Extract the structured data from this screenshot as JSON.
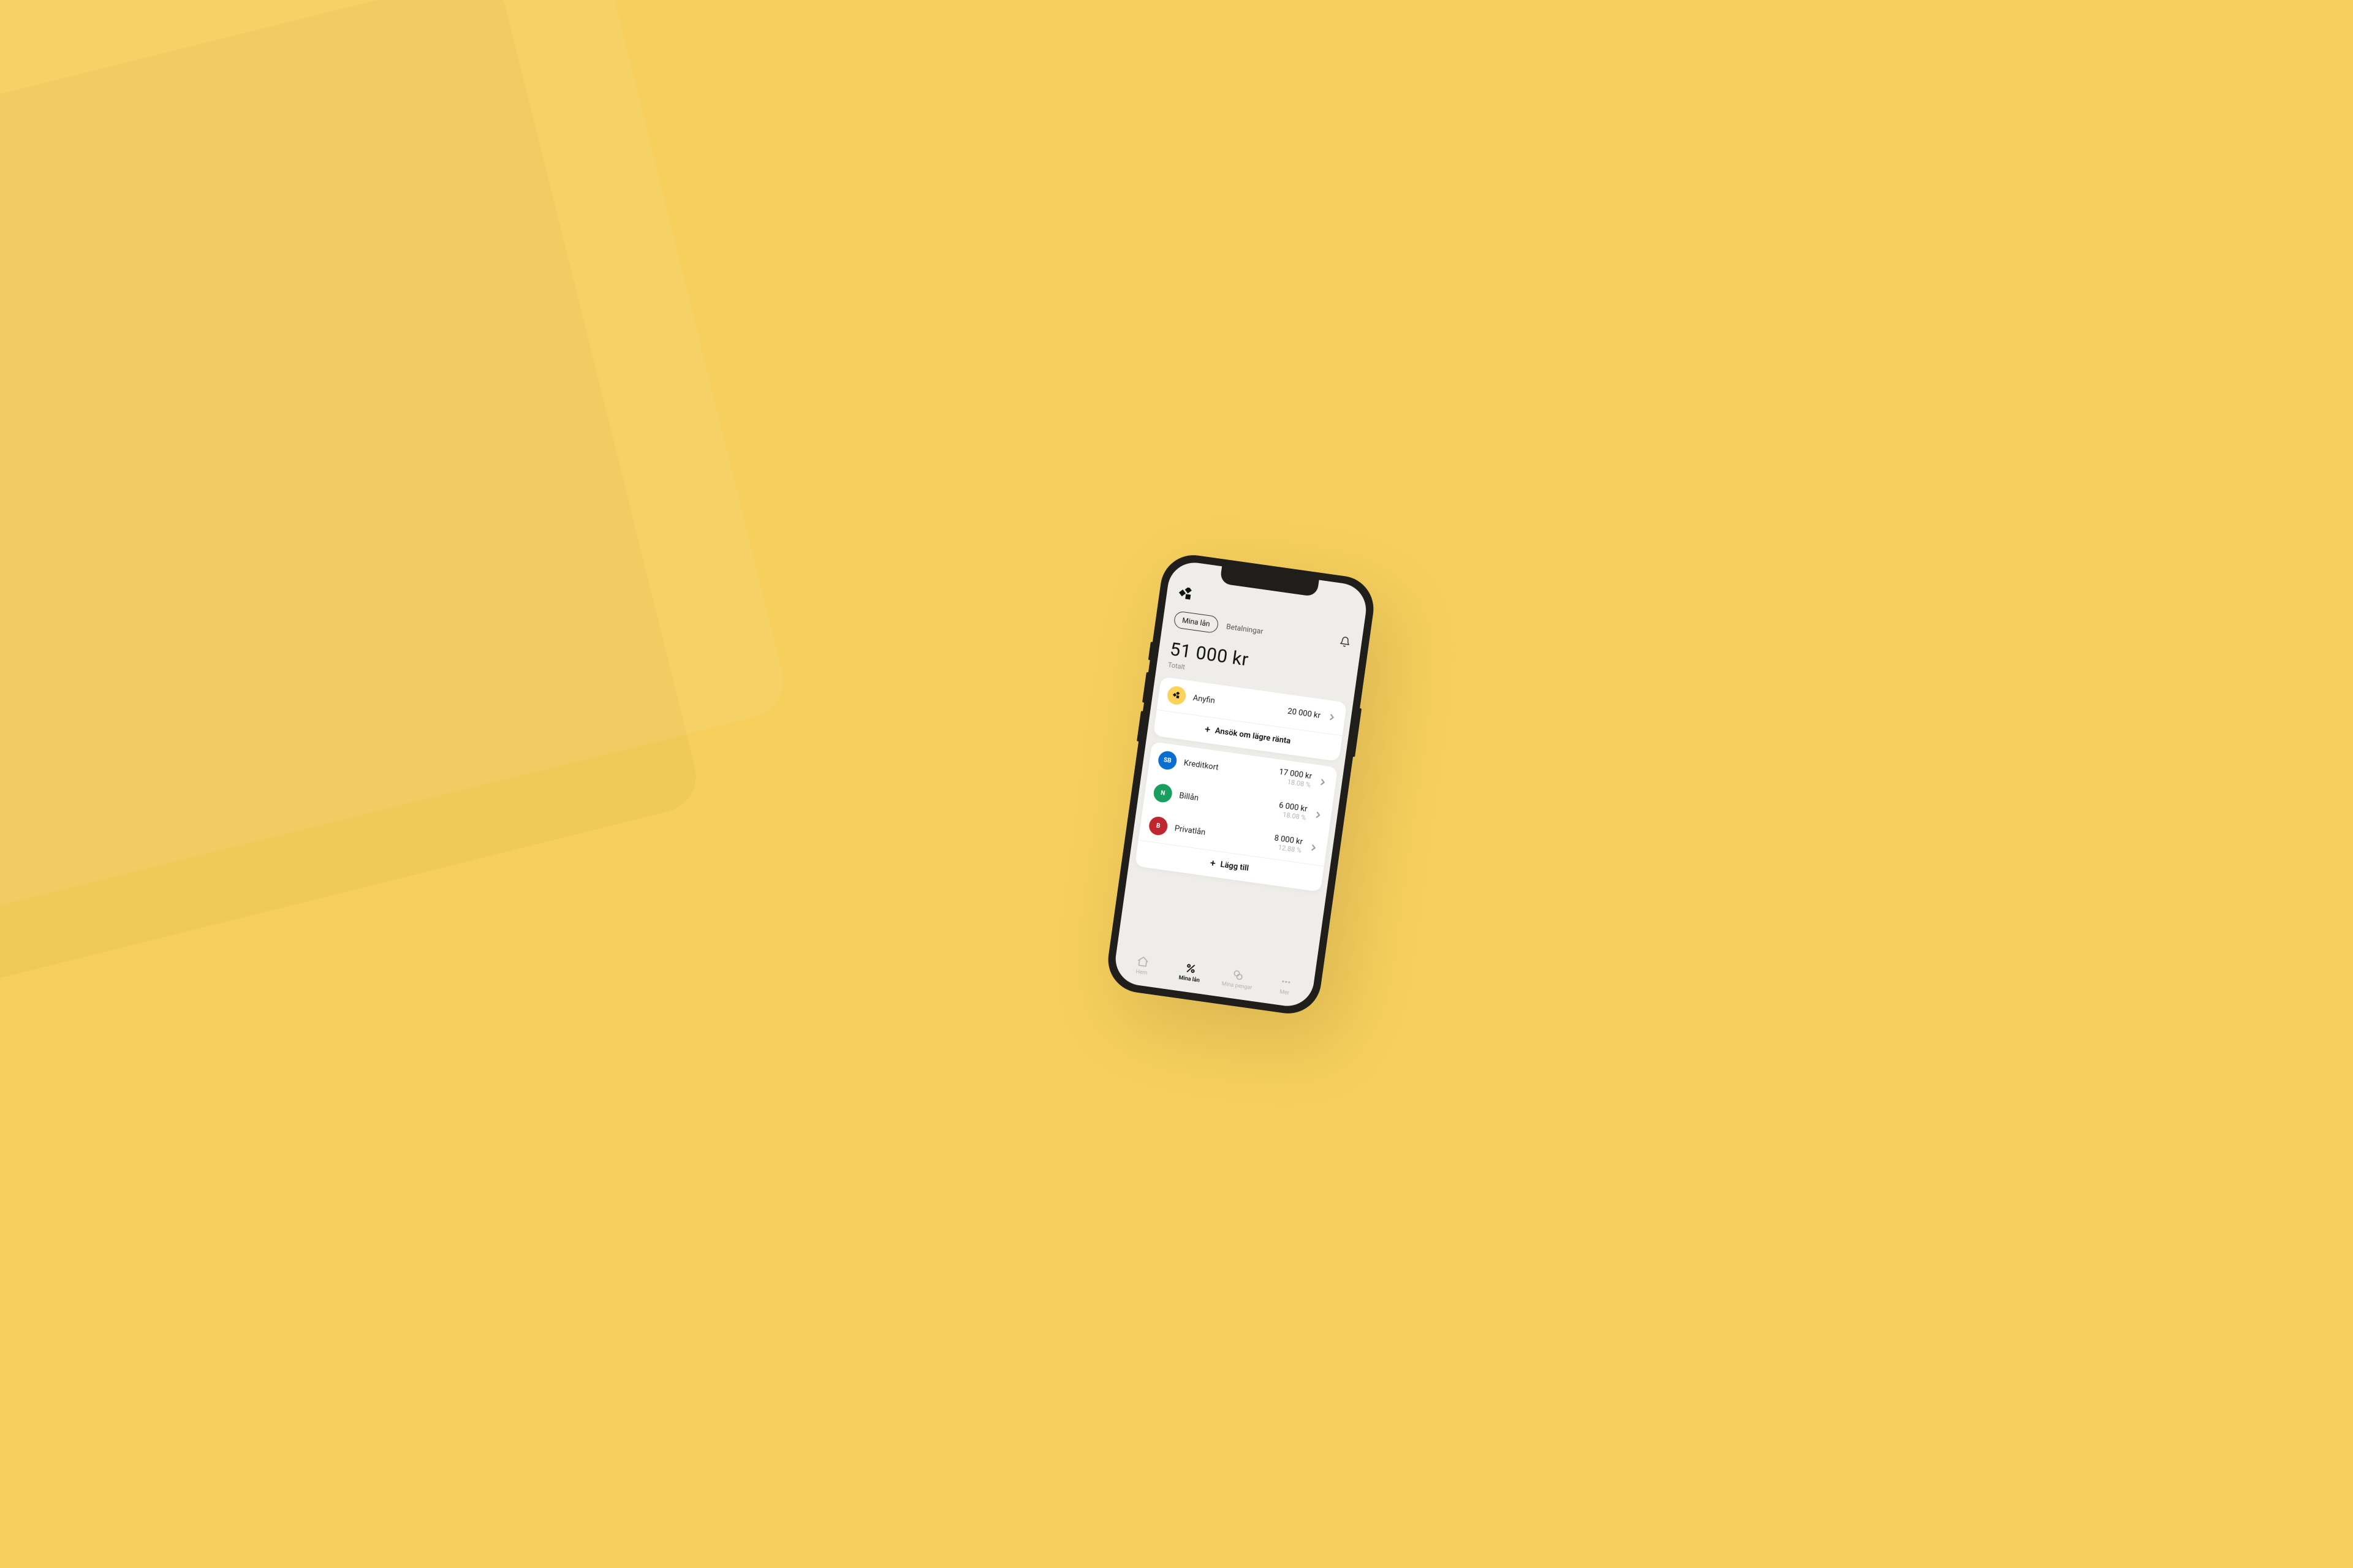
{
  "tabs": {
    "active": "Mina lån",
    "secondary": "Betalningar"
  },
  "total": {
    "amount": "51 000 kr",
    "label": "Totalt"
  },
  "anyfin_card": {
    "lender": "Anyfin",
    "amount": "20 000 kr",
    "action": "Ansök om lägre ränta"
  },
  "loans": [
    {
      "badge": "SB",
      "name": "Kreditkort",
      "amount": "17 000 kr",
      "rate": "18.08 %",
      "color": "#0a6ed1"
    },
    {
      "badge": "N",
      "name": "Billån",
      "amount": "6 000 kr",
      "rate": "18.08 %",
      "color": "#1a9e5f"
    },
    {
      "badge": "B",
      "name": "Privatlån",
      "amount": "8 000 kr",
      "rate": "12.88 %",
      "color": "#c0262d"
    }
  ],
  "add_action": "Lägg till",
  "nav": {
    "home": "Hem",
    "loans": "Mina lån",
    "money": "Mina pengar",
    "more": "Mer"
  }
}
